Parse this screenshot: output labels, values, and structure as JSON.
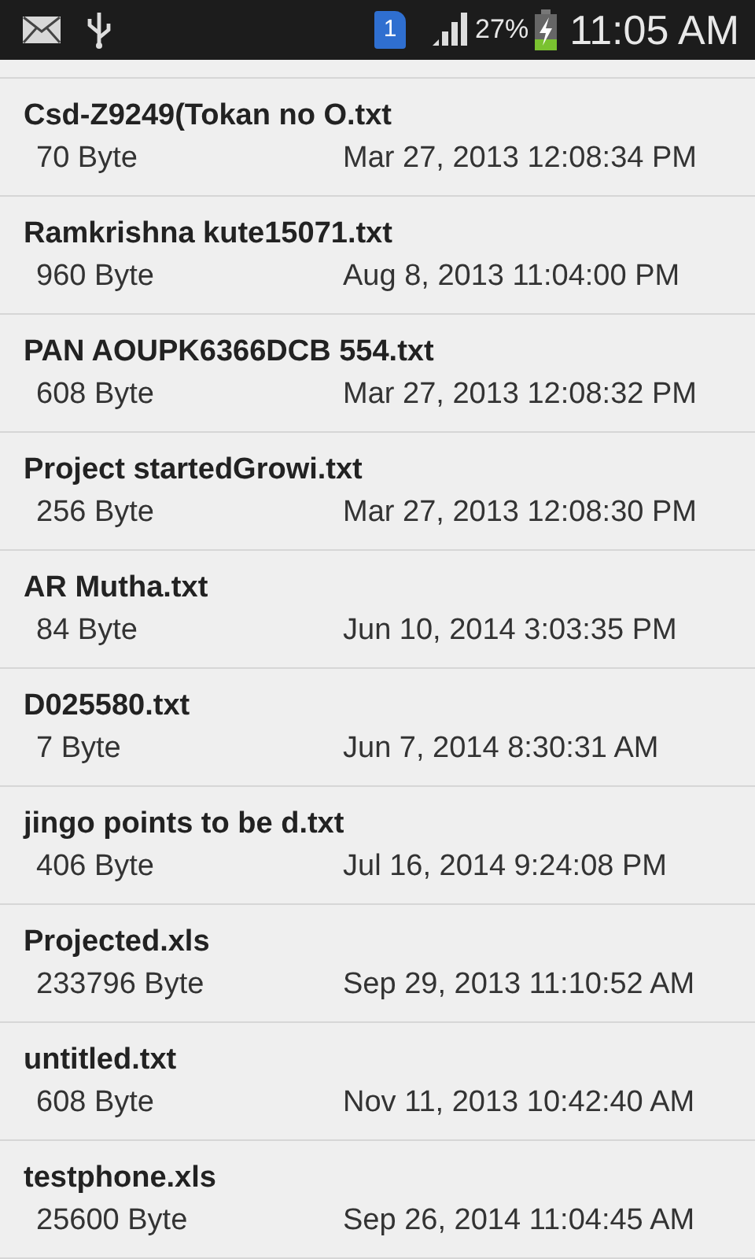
{
  "status_bar": {
    "sim_badge": "1",
    "battery": "27%",
    "time": "11:05 AM"
  },
  "files": [
    {
      "name": "Csd-Z9249(Tokan no O.txt",
      "size": "70 Byte",
      "modified": "Mar 27, 2013 12:08:34 PM"
    },
    {
      "name": "Ramkrishna kute15071.txt",
      "size": "960 Byte",
      "modified": "Aug 8, 2013 11:04:00 PM"
    },
    {
      "name": "PAN AOUPK6366DCB 554.txt",
      "size": "608 Byte",
      "modified": "Mar 27, 2013 12:08:32 PM"
    },
    {
      "name": "Project startedGrowi.txt",
      "size": "256 Byte",
      "modified": "Mar 27, 2013 12:08:30 PM"
    },
    {
      "name": "AR Mutha.txt",
      "size": "84 Byte",
      "modified": "Jun 10, 2014 3:03:35 PM"
    },
    {
      "name": "D025580.txt",
      "size": "7 Byte",
      "modified": "Jun 7, 2014 8:30:31 AM"
    },
    {
      "name": "jingo points to be d.txt",
      "size": "406 Byte",
      "modified": "Jul 16, 2014 9:24:08 PM"
    },
    {
      "name": "Projected.xls",
      "size": "233796 Byte",
      "modified": "Sep 29, 2013 11:10:52 AM"
    },
    {
      "name": "untitled.txt",
      "size": "608 Byte",
      "modified": "Nov 11, 2013 10:42:40 AM"
    },
    {
      "name": "testphone.xls",
      "size": "25600 Byte",
      "modified": "Sep 26, 2014 11:04:45 AM"
    }
  ]
}
